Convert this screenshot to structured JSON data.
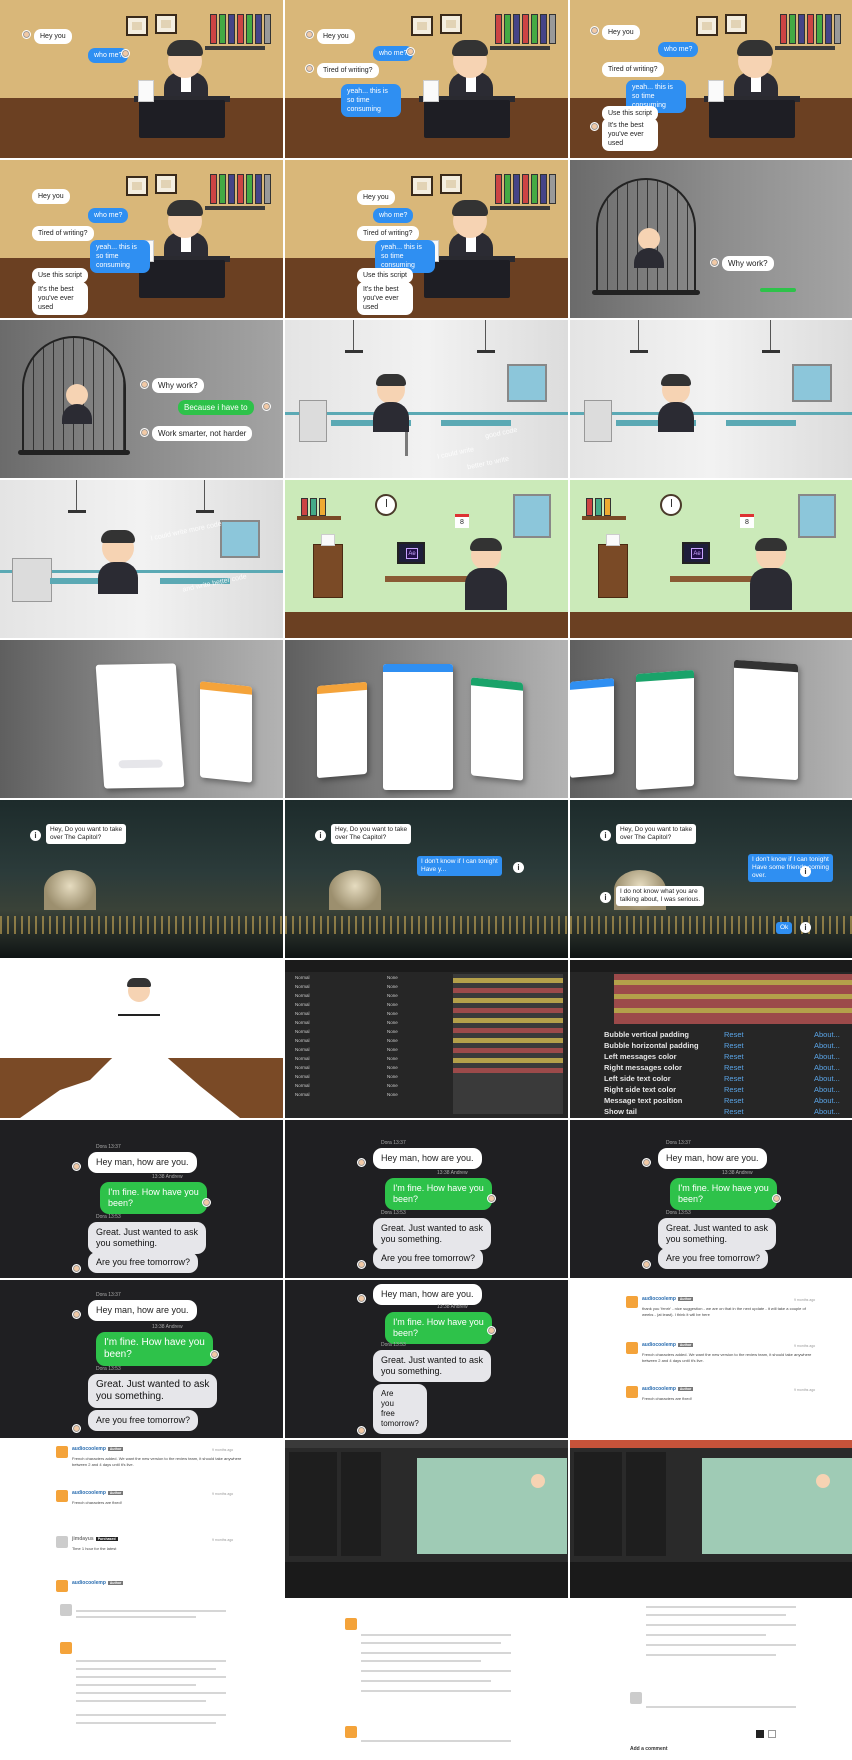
{
  "office": {
    "hey": "Hey you",
    "who": "who me?",
    "tired": "Tired of writing?",
    "yeah_line1": "yeah... this is so time",
    "yeah_line2": "consuming",
    "script": "Use this script",
    "best_line1": "It's the best you've",
    "best_line2": "ever used"
  },
  "cage": {
    "why": "Why work?",
    "because": "Because i have to",
    "smarter": "Work smarter, not harder"
  },
  "float": {
    "t1": "good code",
    "t2": "I could write",
    "t3": "better to write",
    "t4": "I could write more code",
    "t5": "and write better code"
  },
  "green_office": {
    "ae": "Ae",
    "calendar_day": "8"
  },
  "city": {
    "q_line1": "Hey, Do you want to take",
    "q_line2": "over The Capitol?",
    "a_line1": "I don't know if I can tonight",
    "a_line2": "Have y...",
    "a2_line1": "I don't know if I can tonight",
    "a2_line2": "Have some friends coming",
    "a2_line3": "over.",
    "r_line1": "I do not know what you are",
    "r_line2": "talking about, I was serious.",
    "ok": "Ok"
  },
  "ae_panel": {
    "props": [
      "Bubble vertical padding",
      "Bubble horizontal padding",
      "Left messages color",
      "Right messages color",
      "Left side text color",
      "Right side text color",
      "Message text position",
      "Show tail"
    ],
    "reset": "Reset",
    "about": "About...",
    "mode": "Normal",
    "none": "None"
  },
  "dark_chat": {
    "ts1": "Dora  13:37",
    "m1": "Hey man, how are you.",
    "ts2": "13:38  Andrew",
    "m2_line1": "I'm fine. How have you",
    "m2_line2": "been?",
    "ts3": "Dora  13:53",
    "m3_line1": "Great. Just wanted to ask",
    "m3_line2": "you something.",
    "m4": "Are you free tomorrow?",
    "m4_wrap": [
      "Are",
      "you",
      "free",
      "tomorrow?"
    ]
  },
  "comments": {
    "user1": "audiocoolemp",
    "badge": "Author",
    "time": "9 months ago",
    "c1": "thank you 'fenrir' - nice suggestion - we are on that in the next update - it will take a couple of weeks - (at least). I think it will be here",
    "c2": "French characters are fixed!",
    "c3": "French characters added. We want the new version to the review team, it should take anywhere between 2 and 4 days until it's live.",
    "user2": "jimdayus",
    "badge2": "Purchased",
    "c4": "Time 1 hour for the latest",
    "add_comment": "Add a comment"
  }
}
